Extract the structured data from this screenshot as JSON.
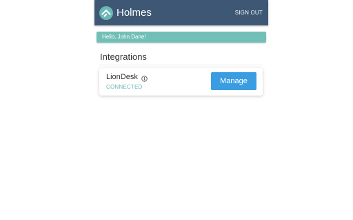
{
  "header": {
    "title": "Holmes",
    "logo_icon": "house-icon",
    "sign_out_label": "SIGN OUT"
  },
  "greeting": {
    "text": "Hello, John Dane!"
  },
  "section": {
    "title": "Integrations"
  },
  "integrations": [
    {
      "name": "LionDesk",
      "info_icon": "info-icon",
      "status": "CONNECTED",
      "action_label": "Manage"
    }
  ],
  "colors": {
    "header_bg": "#3d5775",
    "accent_teal": "#72bfb7",
    "button_blue": "#3a9de2"
  }
}
